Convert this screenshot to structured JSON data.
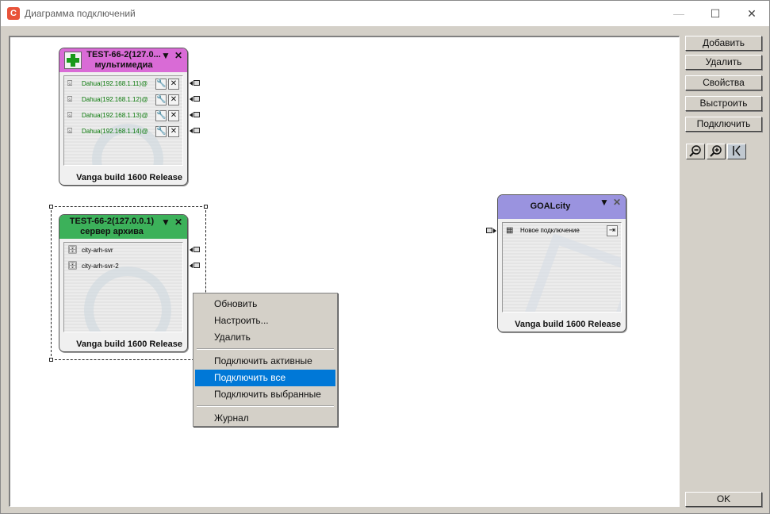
{
  "window": {
    "title": "Диаграмма подключений",
    "icon": "app-logo-icon"
  },
  "titlebar_buttons": {
    "minimize": "—",
    "maximize": "☐",
    "close": "✕"
  },
  "nodes": [
    {
      "title_line1": "TEST-66-2(127.0...",
      "title_line2": "мультимедиа",
      "head_color": "#d96bd6",
      "footer": "Vanga build  1600 Release",
      "rows": [
        {
          "label": "Dahua(192.168.1.11)@"
        },
        {
          "label": "Dahua(192.168.1.12)@"
        },
        {
          "label": "Dahua(192.168.1.13)@"
        },
        {
          "label": "Dahua(192.168.1.14)@"
        }
      ]
    },
    {
      "title_line1": "TEST-66-2(127.0.0.1)",
      "title_line2": "сервер архива",
      "head_color": "#3cb15a",
      "footer": "Vanga build  1600 Release",
      "rows": [
        {
          "label": "city-arh-svr"
        },
        {
          "label": "city-arh-svr-2"
        }
      ]
    },
    {
      "title_line1": "GOALcity",
      "head_color": "#9a93df",
      "footer": "Vanga build  1600 Release",
      "rows": [
        {
          "label": "Новое подключение"
        }
      ]
    }
  ],
  "context_menu": {
    "items": [
      "Обновить",
      "Настроить...",
      "Удалить",
      "Подключить активные",
      "Подключить все",
      "Подключить выбранные",
      "Журнал"
    ],
    "highlighted": "Подключить все"
  },
  "sidebar": {
    "buttons": [
      "Добавить",
      "Удалить",
      "Свойства",
      "Выстроить",
      "Подключить"
    ],
    "zoom": [
      "zoom-out-icon",
      "zoom-in-icon",
      "fit-view-icon"
    ],
    "ok": "OK"
  },
  "colors": {
    "highlight": "#0078d7",
    "face": "#d4d0c8"
  }
}
